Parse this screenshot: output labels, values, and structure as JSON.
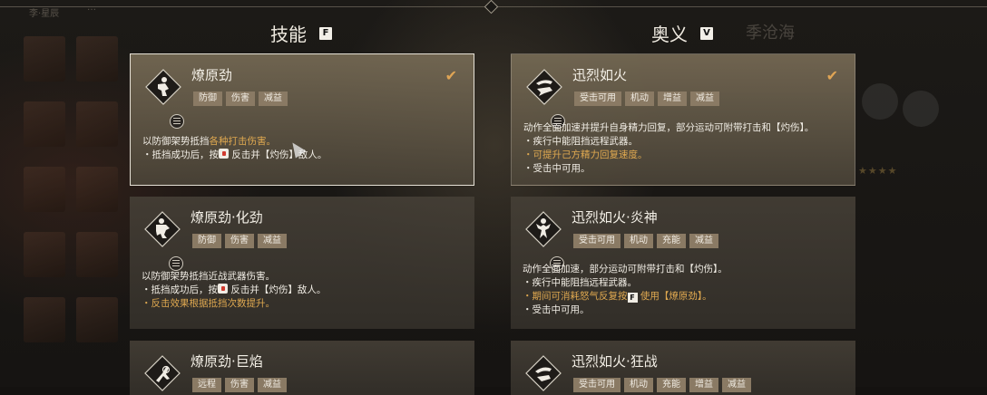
{
  "top": {
    "dim_text_1": "李·星辰",
    "dim_text_2": "…"
  },
  "columns": {
    "left": {
      "title": "技能",
      "key": "F"
    },
    "right": {
      "title": "奥义",
      "key": "V"
    }
  },
  "background": {
    "right_name": "季沧海",
    "stars": "★★★★"
  },
  "skills": [
    {
      "title": "燎原劲",
      "tags": [
        "防御",
        "伤害",
        "减益"
      ],
      "selected": true,
      "icon": "martial-stance-icon",
      "lines": [
        {
          "a": "以防御架势抵挡",
          "hl": "各种打击伤害。"
        },
        {
          "a": "・抵挡成功后，按",
          "b": "反击并【灼伤】敌人。"
        }
      ]
    },
    {
      "title": "燎原劲·化劲",
      "tags": [
        "防御",
        "伤害",
        "减益"
      ],
      "selected": false,
      "icon": "parry-stance-icon",
      "lines": [
        {
          "a": "以防御架势抵挡近战武器伤害。"
        },
        {
          "a": "・抵挡成功后，按",
          "b": "反击并【灼伤】敌人。"
        },
        {
          "hl": "・反击效果根据抵挡次数提升。"
        }
      ]
    },
    {
      "title": "燎原劲·巨焰",
      "tags": [
        "远程",
        "伤害",
        "减益"
      ],
      "selected": false,
      "icon": "flame-kick-icon"
    }
  ],
  "ultimates": [
    {
      "title": "迅烈如火",
      "tags": [
        "受击可用",
        "机动",
        "增益",
        "减益"
      ],
      "selected": true,
      "icon": "dash-strike-icon",
      "lines": [
        {
          "a": "动作全面加速并提升自身精力回复，部分运动可附带打击和【灼伤】。"
        },
        {
          "a": "・疾行中能阻挡远程武器。"
        },
        {
          "hl": "・可提升己方精力回复速度。"
        },
        {
          "a": "・受击中可用。"
        }
      ]
    },
    {
      "title": "迅烈如火·炎神",
      "tags": [
        "受击可用",
        "机动",
        "充能",
        "减益"
      ],
      "selected": false,
      "icon": "flame-god-icon",
      "lines": [
        {
          "a": "动作全面加速，部分运动可附带打击和【灼伤】。"
        },
        {
          "a": "・疾行中能阻挡远程武器。"
        },
        {
          "hl1": "・期间可消耗怒气反复按",
          "key": "F",
          "hl2": "使用【燎原劲】。"
        },
        {
          "a": "・受击中可用。"
        }
      ]
    },
    {
      "title": "迅烈如火·狂战",
      "tags": [
        "受击可用",
        "机动",
        "充能",
        "增益",
        "减益"
      ],
      "selected": false,
      "icon": "berserk-dash-icon"
    }
  ]
}
